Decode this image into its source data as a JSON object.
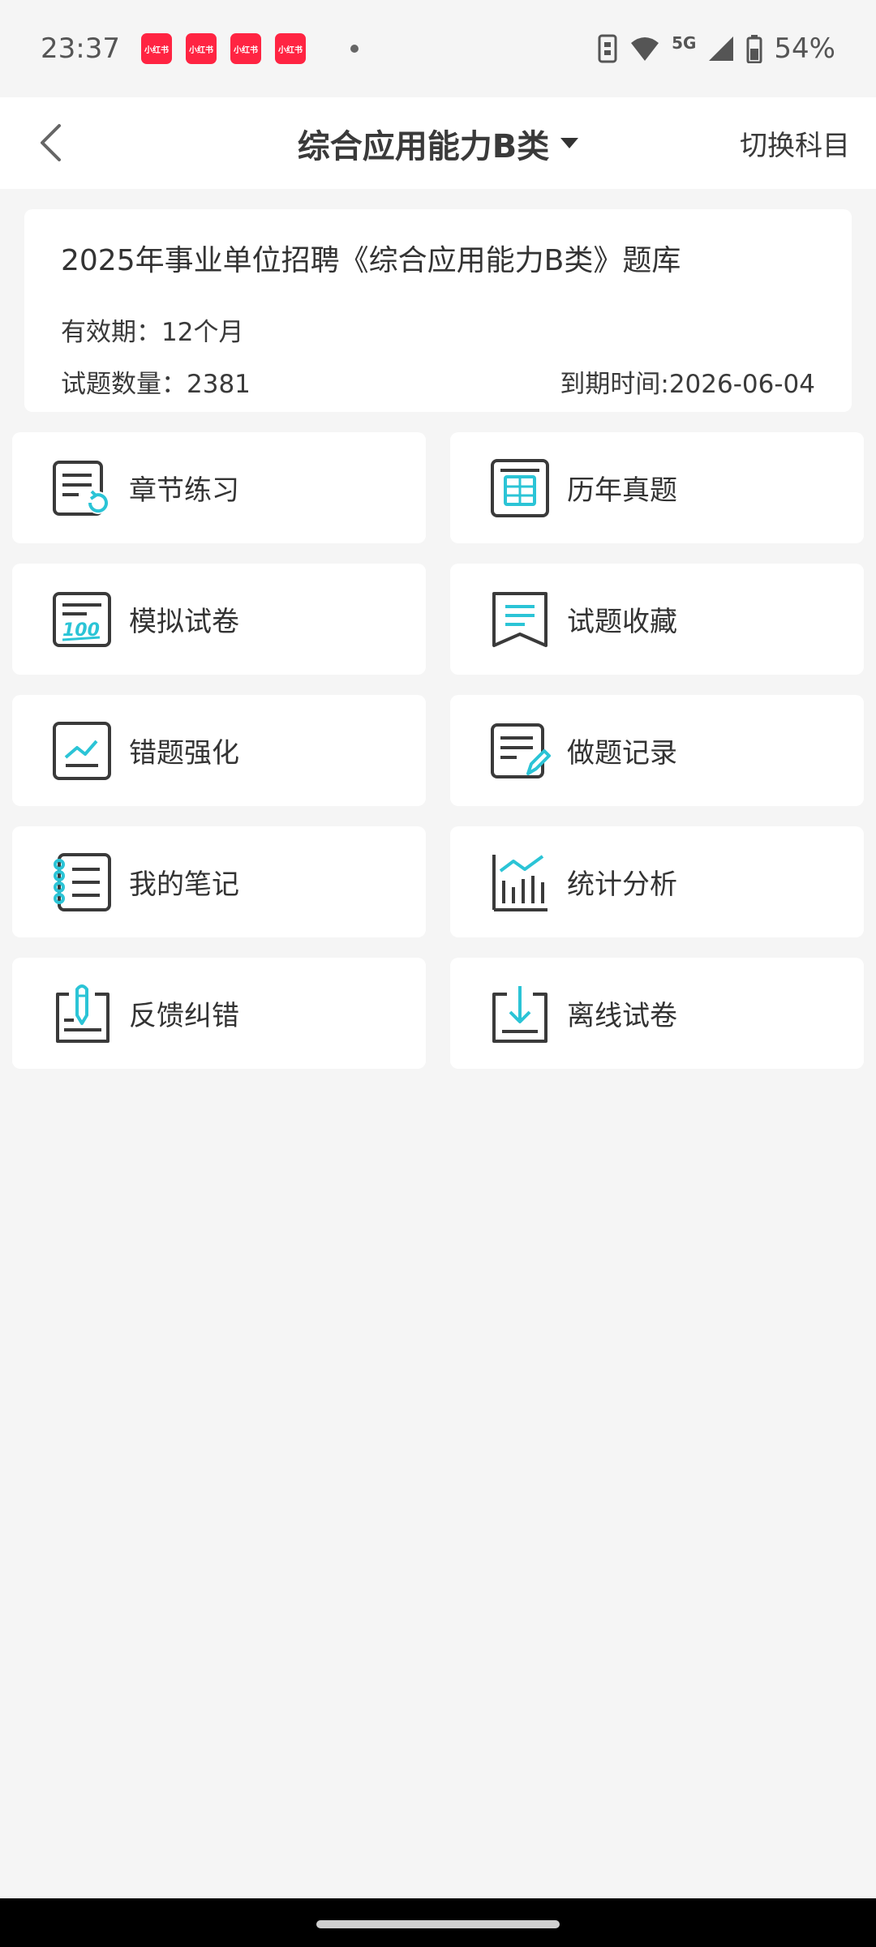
{
  "status": {
    "time": "23:37",
    "notif_label": "小红书",
    "network": "5G",
    "battery": "54%"
  },
  "header": {
    "title": "综合应用能力B类",
    "switch_label": "切换科目"
  },
  "info": {
    "title": "2025年事业单位招聘《综合应用能力B类》题库",
    "validity": "有效期：12个月",
    "count": "试题数量：2381",
    "expire": "到期时间:2026-06-04"
  },
  "tiles": [
    {
      "label": "章节练习",
      "icon": "chapter-practice-icon"
    },
    {
      "label": "历年真题",
      "icon": "past-papers-icon"
    },
    {
      "label": "模拟试卷",
      "icon": "mock-exam-icon"
    },
    {
      "label": "试题收藏",
      "icon": "favorites-icon"
    },
    {
      "label": "错题强化",
      "icon": "mistakes-icon"
    },
    {
      "label": "做题记录",
      "icon": "records-icon"
    },
    {
      "label": "我的笔记",
      "icon": "notes-icon"
    },
    {
      "label": "统计分析",
      "icon": "statistics-icon"
    },
    {
      "label": "反馈纠错",
      "icon": "feedback-icon"
    },
    {
      "label": "离线试卷",
      "icon": "offline-download-icon"
    }
  ],
  "colors": {
    "accent": "#2bc4d6",
    "icon_dark": "#3a3a3a",
    "background": "#f5f5f5",
    "notif": "#ff2442"
  }
}
